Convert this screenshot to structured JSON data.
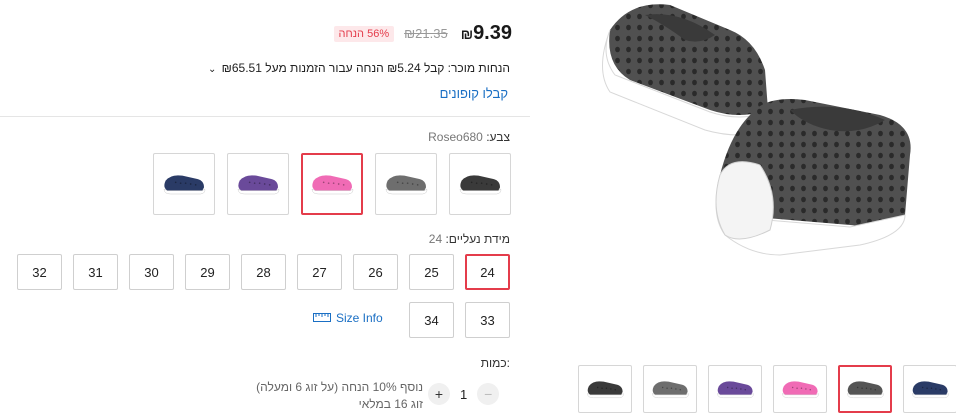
{
  "price": {
    "amount": "9.39",
    "currency": "₪",
    "original": "₪21.35",
    "discount_badge": "56% הנחה"
  },
  "seller_discounts": {
    "text": "הנחות מוכר: קבל ₪5.24 הנחה עבור הזמנות מעל ₪65.51",
    "chevron": "⌄"
  },
  "coupons_link": "קבלו קופונים",
  "color": {
    "label": "צבע:",
    "selected": "Roseo680",
    "options": [
      {
        "name": "black",
        "color": "#3a3a3a"
      },
      {
        "name": "grey",
        "color": "#6e6e6e"
      },
      {
        "name": "pink",
        "color": "#f06bb5"
      },
      {
        "name": "purple",
        "color": "#6a4a9a"
      },
      {
        "name": "navy",
        "color": "#2a3b66"
      }
    ]
  },
  "size": {
    "label": "מידת נעליים:",
    "selected": "24",
    "options": [
      "24",
      "25",
      "26",
      "27",
      "28",
      "29",
      "30",
      "31",
      "32",
      "33",
      "34"
    ],
    "size_info_label": "Size Info"
  },
  "quantity": {
    "label": "כמות:",
    "value": "1",
    "plus": "+",
    "minus": "−",
    "note_line1": "נוסף 10% הנחה (על זוג 6 ומעלה)",
    "note_line2": "זוג 16 במלאי"
  },
  "thumbnails": [
    {
      "name": "navy",
      "color": "#2a3b66"
    },
    {
      "name": "main-grey",
      "color": "#555555"
    },
    {
      "name": "pink",
      "color": "#f06bb5"
    },
    {
      "name": "purple",
      "color": "#6a4a9a"
    },
    {
      "name": "grey",
      "color": "#6e6e6e"
    },
    {
      "name": "black",
      "color": "#3a3a3a"
    }
  ],
  "colors": {
    "accent": "#e43c4b",
    "link": "#1a6fc4"
  }
}
